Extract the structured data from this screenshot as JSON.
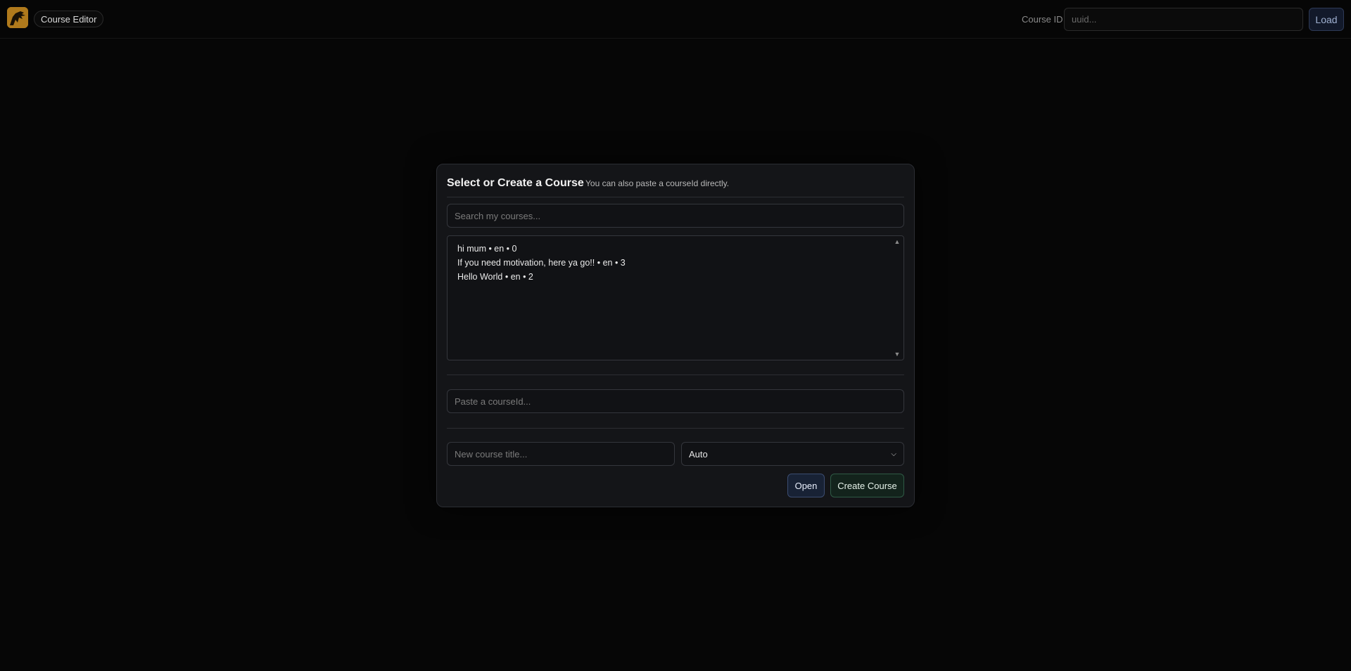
{
  "topbar": {
    "logo_icon": "bird-logo-icon",
    "app_label": "Course Editor",
    "course_id_label": "Course ID",
    "course_id_placeholder": "uuid...",
    "load_label": "Load"
  },
  "modal": {
    "title": "Select or Create a Course",
    "subtitle": "You can also paste a courseId directly.",
    "search_placeholder": "Search my courses...",
    "courses": [
      "hi mum • en • 0",
      "If you need motivation, here ya go!! • en • 3",
      "Hello World • en • 2"
    ],
    "paste_placeholder": "Paste a courseId...",
    "new_title_placeholder": "New course title...",
    "language_value": "Auto",
    "open_label": "Open",
    "create_label": "Create Course"
  },
  "colors": {
    "background": "#060606",
    "panel": "#141518",
    "logo_bg": "#b07a1c",
    "open_accent": "#3b4c70",
    "create_accent": "#2f5a45"
  }
}
